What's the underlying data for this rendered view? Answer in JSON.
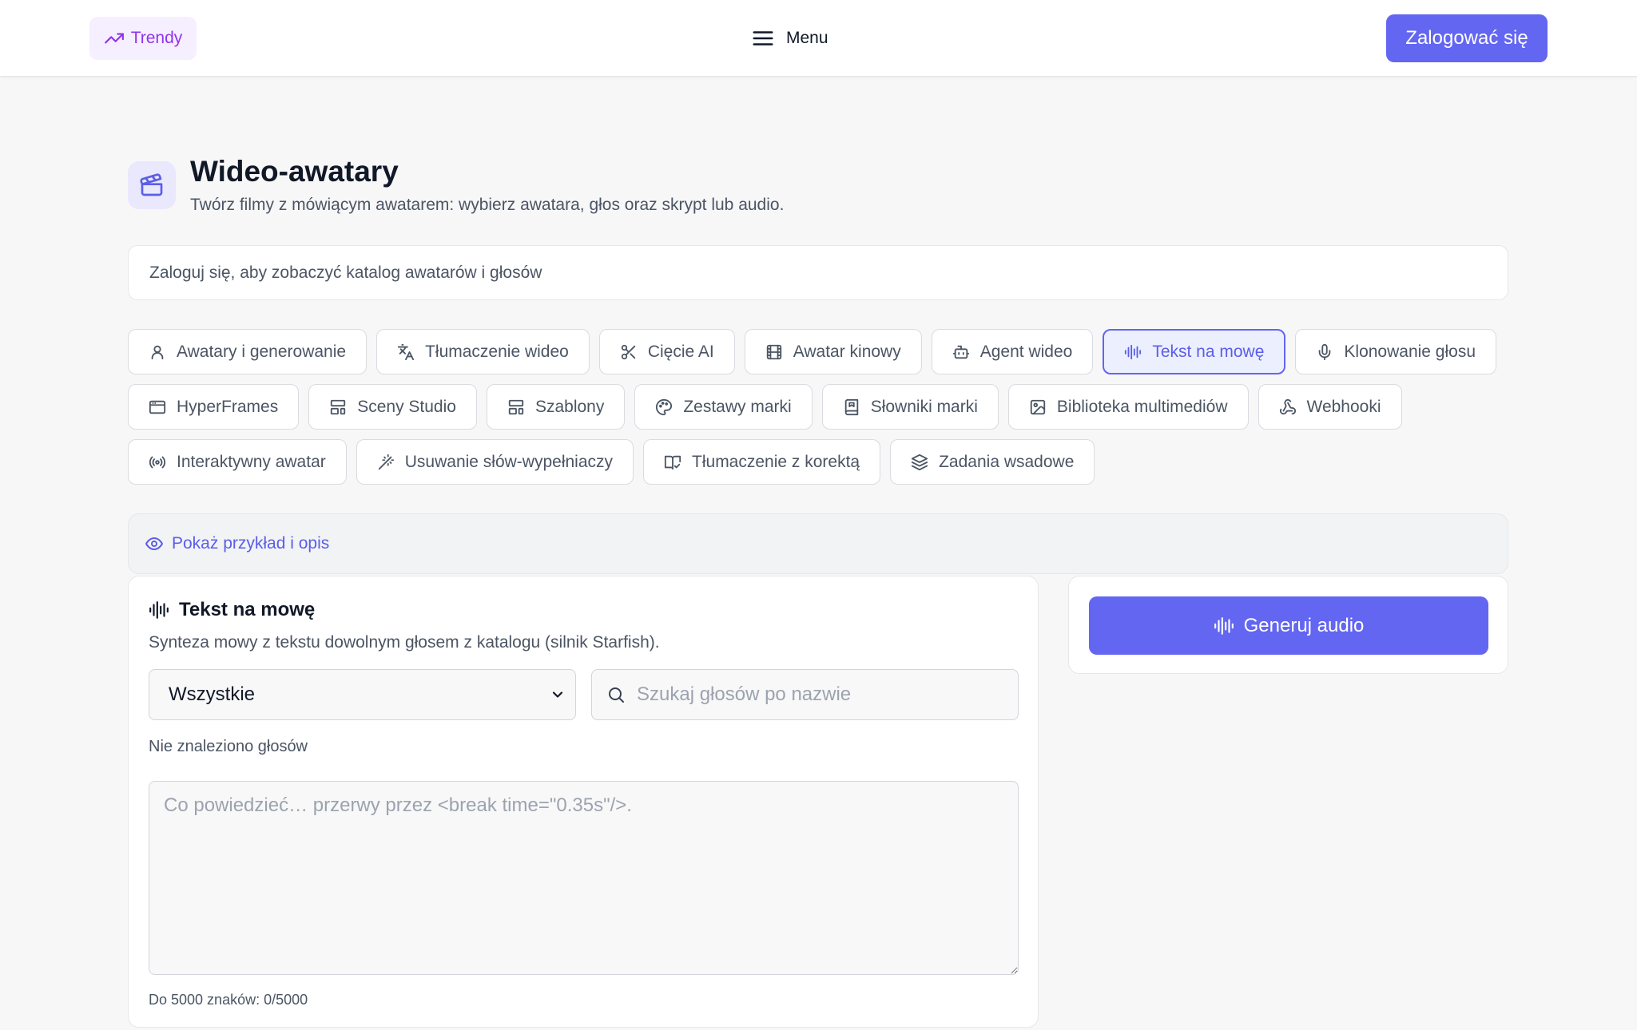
{
  "header": {
    "trend_label": "Trendy",
    "menu_label": "Menu",
    "login_label": "Zalogować się"
  },
  "page": {
    "title": "Wideo-awatary",
    "subtitle": "Twórz filmy z mówiącym awatarem: wybierz awatara, głos oraz skrypt lub audio.",
    "icon": "clapperboard-icon"
  },
  "notice": "Zaloguj się, aby zobaczyć katalog awatarów i głosów",
  "tabs": [
    {
      "label": "Awatary i generowanie",
      "icon": "user-icon"
    },
    {
      "label": "Tłumaczenie wideo",
      "icon": "translate-icon"
    },
    {
      "label": "Cięcie AI",
      "icon": "scissors-icon"
    },
    {
      "label": "Awatar kinowy",
      "icon": "film-icon"
    },
    {
      "label": "Agent wideo",
      "icon": "bot-icon"
    },
    {
      "label": "Tekst na mowę",
      "icon": "audio-waveform-icon",
      "active": true
    },
    {
      "label": "Klonowanie głosu",
      "icon": "microphone-icon"
    },
    {
      "label": "HyperFrames",
      "icon": "browser-window-icon"
    },
    {
      "label": "Sceny Studio",
      "icon": "layout-icon"
    },
    {
      "label": "Szablony",
      "icon": "layout-template-icon"
    },
    {
      "label": "Zestawy marki",
      "icon": "palette-icon"
    },
    {
      "label": "Słowniki marki",
      "icon": "book-icon"
    },
    {
      "label": "Biblioteka multimediów",
      "icon": "image-icon"
    },
    {
      "label": "Webhooki",
      "icon": "webhook-icon"
    },
    {
      "label": "Interaktywny awatar",
      "icon": "radio-waves-icon"
    },
    {
      "label": "Usuwanie słów-wypełniaczy",
      "icon": "magic-wand-icon"
    },
    {
      "label": "Tłumaczenie z korektą",
      "icon": "book-check-icon"
    },
    {
      "label": "Zadania wsadowe",
      "icon": "layers-icon"
    }
  ],
  "example_toggle": "Pokaż przykład i opis",
  "tts": {
    "title": "Tekst na mowę",
    "description": "Synteza mowy z tekstu dowolnym głosem z katalogu (silnik Starfish).",
    "filter_selected": "Wszystkie",
    "search_placeholder": "Szukaj głosów po nazwie",
    "no_voices": "Nie znaleziono głosów",
    "script_placeholder": "Co powiedzieć… przerwy przez <break time=\"0.35s\"/>.",
    "char_count": "Do 5000 znaków: 0/5000"
  },
  "generate": {
    "label": "Generuj audio"
  },
  "colors": {
    "accent": "#6366f1",
    "trend": "#9333ea",
    "active_tab_bg": "#eceffe"
  }
}
